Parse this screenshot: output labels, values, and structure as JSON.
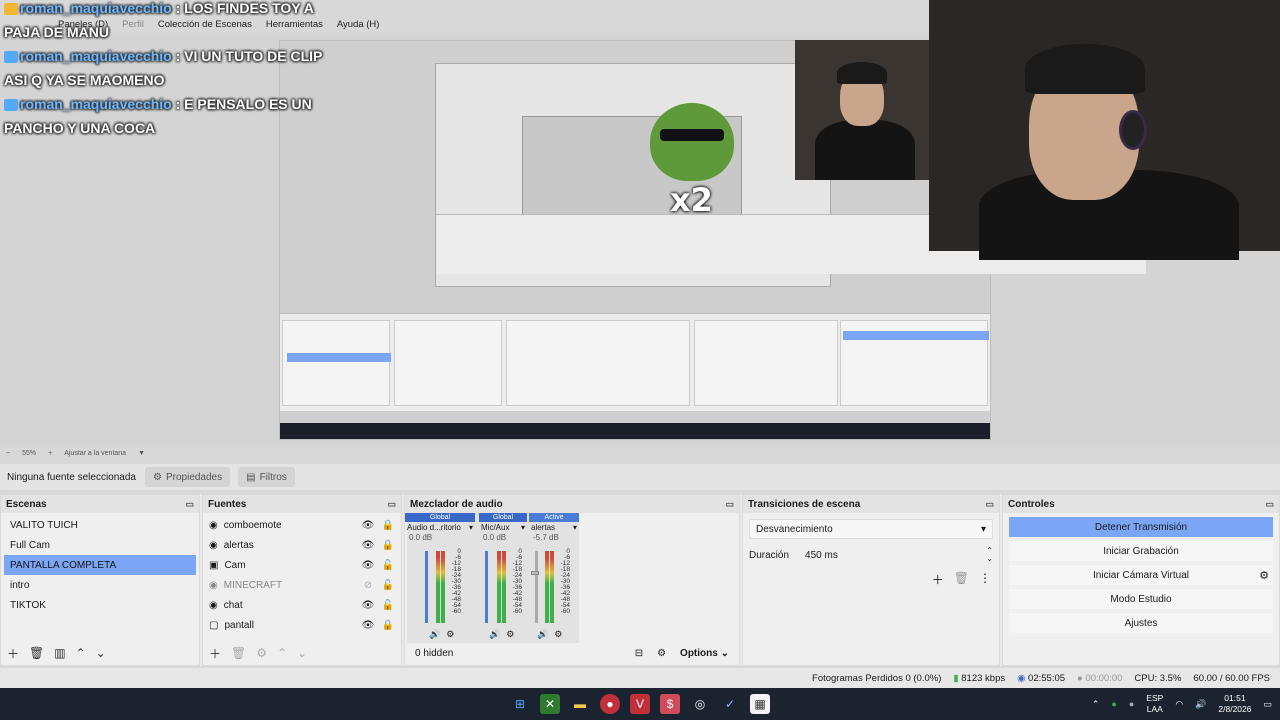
{
  "menubar": {
    "items": [
      "Paneles (D)",
      "Perfil",
      "Colección de Escenas",
      "Herramientas",
      "Ayuda (H)"
    ]
  },
  "chat": {
    "lines": [
      {
        "user": "roman_maquiavecchio",
        "message": ": LOS FINDES TOY A"
      },
      {
        "user": "",
        "message": "PAJA DE MANU"
      },
      {
        "user": "roman_maquiavecchio",
        "message": ": VI UN TUTO DE CLIP"
      },
      {
        "user": "",
        "message": "ASI Q YA SE MAOMENO"
      },
      {
        "user": "roman_maquiavecchio",
        "message": ": E PENSALO ES UN"
      },
      {
        "user": "",
        "message": "PANCHO Y UNA COCA"
      }
    ]
  },
  "overlay": {
    "multiplier": "x2"
  },
  "zoombar": {
    "zoom": "55%",
    "fit": "Ajustar a la ventana"
  },
  "source_toolbar": {
    "no_source": "Ninguna fuente seleccionada",
    "properties": "Propiedades",
    "filters": "Filtros"
  },
  "scenes": {
    "title": "Escenas",
    "items": [
      "VALITO TUICH",
      "Full Cam",
      "PANTALLA COMPLETA",
      "intro",
      "TIKTOK"
    ],
    "selected_index": 2
  },
  "sources": {
    "title": "Fuentes",
    "items": [
      {
        "name": "comboemote",
        "icon": "globe-icon",
        "visible": true,
        "locked": true
      },
      {
        "name": "alertas",
        "icon": "globe-icon",
        "visible": true,
        "locked": true
      },
      {
        "name": "Cam",
        "icon": "camera-icon",
        "visible": true,
        "locked": false
      },
      {
        "name": "MINECRAFT",
        "icon": "globe-icon",
        "visible": false,
        "locked": false
      },
      {
        "name": "chat",
        "icon": "globe-icon",
        "visible": true,
        "locked": false
      },
      {
        "name": "pantall",
        "icon": "monitor-icon",
        "visible": true,
        "locked": true
      }
    ]
  },
  "mixer": {
    "title": "Mezclador de audio",
    "strips": [
      {
        "badge": "Global",
        "name": "Audio d...ritorio",
        "db": "0.0 dB"
      },
      {
        "badge": "Global",
        "name": "Mic/Aux",
        "db": "0.0 dB"
      },
      {
        "badge": "Active",
        "name": "alertas",
        "db": "-5.7 dB"
      }
    ],
    "scale": [
      "0",
      "-6",
      "-12",
      "-18",
      "-24",
      "-30",
      "-36",
      "-42",
      "-48",
      "-54",
      "-60"
    ],
    "hidden": "0 hidden",
    "options": "Options"
  },
  "transitions": {
    "title": "Transiciones de escena",
    "selected": "Desvanecimiento",
    "duration_label": "Duración",
    "duration_value": "450 ms"
  },
  "controls": {
    "title": "Controles",
    "buttons": [
      "Detener Transmisión",
      "Iniciar Grabación",
      "Iniciar Cámara Virtual",
      "Modo Estudio",
      "Ajustes"
    ]
  },
  "status": {
    "dropped": "Fotogramas Perdidos 0 (0.0%)",
    "bitrate": "8123 kbps",
    "stream_time": "02:55:05",
    "rec_time": "00:00:00",
    "cpu": "CPU: 3.5%",
    "fps": "60.00 / 60.00 FPS"
  },
  "taskbar": {
    "lang_top": "ESP",
    "lang_bottom": "LAA",
    "time": "01:51",
    "date": "2/8/2026"
  },
  "colors": {
    "accent": "#7aa6f5",
    "taskbar": "#1c2330"
  }
}
